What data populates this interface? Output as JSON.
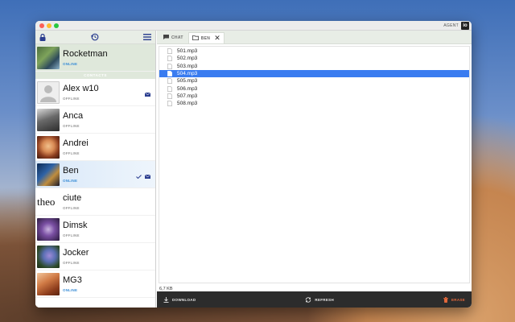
{
  "app": {
    "brand_text": "AGENT",
    "brand_logo": "io"
  },
  "sidebar": {
    "icons": [
      "lock-icon",
      "history-icon",
      "menu-icon"
    ],
    "current_user": {
      "name": "Rocketman",
      "status": "ONLINE"
    },
    "contacts_header": "CONTACTS",
    "contacts": [
      {
        "name": "Alex w10",
        "status": "OFFLINE",
        "avatar": "placeholder",
        "has_message": true
      },
      {
        "name": "Anca",
        "status": "OFFLINE",
        "avatar": "photo"
      },
      {
        "name": "Andrei",
        "status": "OFFLINE",
        "avatar": "photo"
      },
      {
        "name": "Ben",
        "status": "ONLINE",
        "avatar": "photo",
        "has_message": true,
        "checked": true,
        "selected": true
      },
      {
        "name": "ciute",
        "status": "OFFLINE",
        "avatar": "text",
        "avatar_text": "theo"
      },
      {
        "name": "Dimsk",
        "status": "OFFLINE",
        "avatar": "photo"
      },
      {
        "name": "Jocker",
        "status": "OFFLINE",
        "avatar": "photo"
      },
      {
        "name": "MG3",
        "status": "ONLINE",
        "avatar": "photo"
      }
    ]
  },
  "tabs": [
    {
      "label": "CHAT",
      "icon": "chat-icon"
    },
    {
      "label": "BEN",
      "icon": "folder-icon",
      "close": "✕",
      "active": true
    }
  ],
  "files": [
    {
      "name": "501.mp3"
    },
    {
      "name": "502.mp3"
    },
    {
      "name": "503.mp3"
    },
    {
      "name": "504.mp3",
      "selected": true
    },
    {
      "name": "505.mp3"
    },
    {
      "name": "506.mp3"
    },
    {
      "name": "507.mp3"
    },
    {
      "name": "508.mp3"
    }
  ],
  "status_text": "6,7 KB",
  "bottom": {
    "download_label": "DOWNLOAD",
    "refresh_label": "REFRESH",
    "erase_label": "ERASE"
  },
  "colors": {
    "accent": "#3a7cf0",
    "online": "#3d8fd6",
    "erase": "#e3683b",
    "sidebar_header": "#e8ede6"
  }
}
